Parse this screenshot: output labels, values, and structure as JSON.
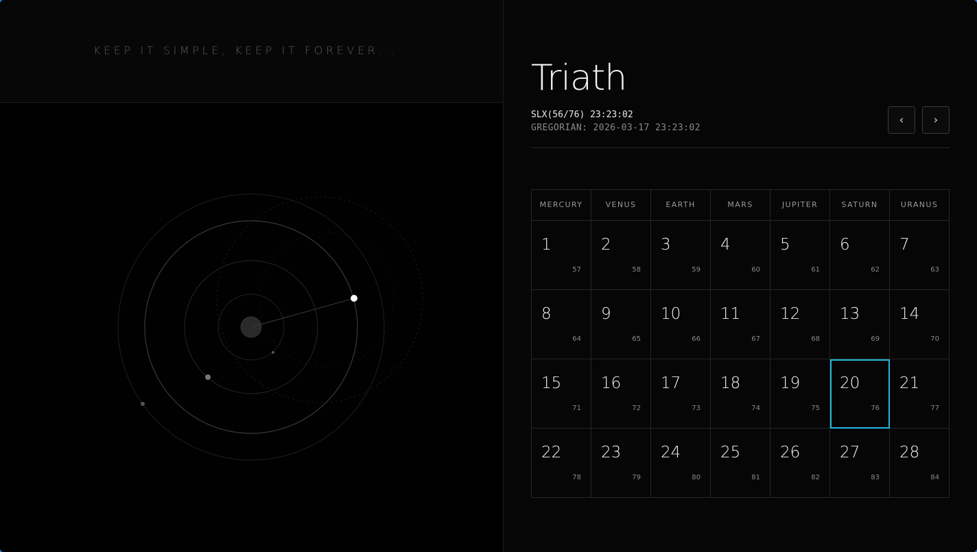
{
  "tagline": "KEEP IT SIMPLE, KEEP IT FOREVER...",
  "title": "Triath",
  "slx_time": "SLX(56/76) 23:23:02",
  "gregorian_time": "GREGORIAN: 2026-03-17 23:23:02",
  "nav": {
    "prev": "‹",
    "next": "›"
  },
  "weekdays": [
    "MERCURY",
    "VENUS",
    "EARTH",
    "MARS",
    "JUPITER",
    "SATURN",
    "URANUS"
  ],
  "weeks": [
    [
      {
        "day": "1",
        "sub": "57"
      },
      {
        "day": "2",
        "sub": "58"
      },
      {
        "day": "3",
        "sub": "59"
      },
      {
        "day": "4",
        "sub": "60"
      },
      {
        "day": "5",
        "sub": "61"
      },
      {
        "day": "6",
        "sub": "62"
      },
      {
        "day": "7",
        "sub": "63"
      }
    ],
    [
      {
        "day": "8",
        "sub": "64"
      },
      {
        "day": "9",
        "sub": "65"
      },
      {
        "day": "10",
        "sub": "66"
      },
      {
        "day": "11",
        "sub": "67"
      },
      {
        "day": "12",
        "sub": "68"
      },
      {
        "day": "13",
        "sub": "69"
      },
      {
        "day": "14",
        "sub": "70"
      }
    ],
    [
      {
        "day": "15",
        "sub": "71"
      },
      {
        "day": "16",
        "sub": "72"
      },
      {
        "day": "17",
        "sub": "73"
      },
      {
        "day": "18",
        "sub": "74"
      },
      {
        "day": "19",
        "sub": "75"
      },
      {
        "day": "20",
        "sub": "76",
        "selected": true
      },
      {
        "day": "21",
        "sub": "77"
      }
    ],
    [
      {
        "day": "22",
        "sub": "78"
      },
      {
        "day": "23",
        "sub": "79"
      },
      {
        "day": "24",
        "sub": "80"
      },
      {
        "day": "25",
        "sub": "81"
      },
      {
        "day": "26",
        "sub": "82"
      },
      {
        "day": "27",
        "sub": "83"
      },
      {
        "day": "28",
        "sub": "84"
      }
    ]
  ],
  "colors": {
    "accent": "#22b8e0",
    "background": "#050505",
    "glow": "#2f6fd0"
  }
}
